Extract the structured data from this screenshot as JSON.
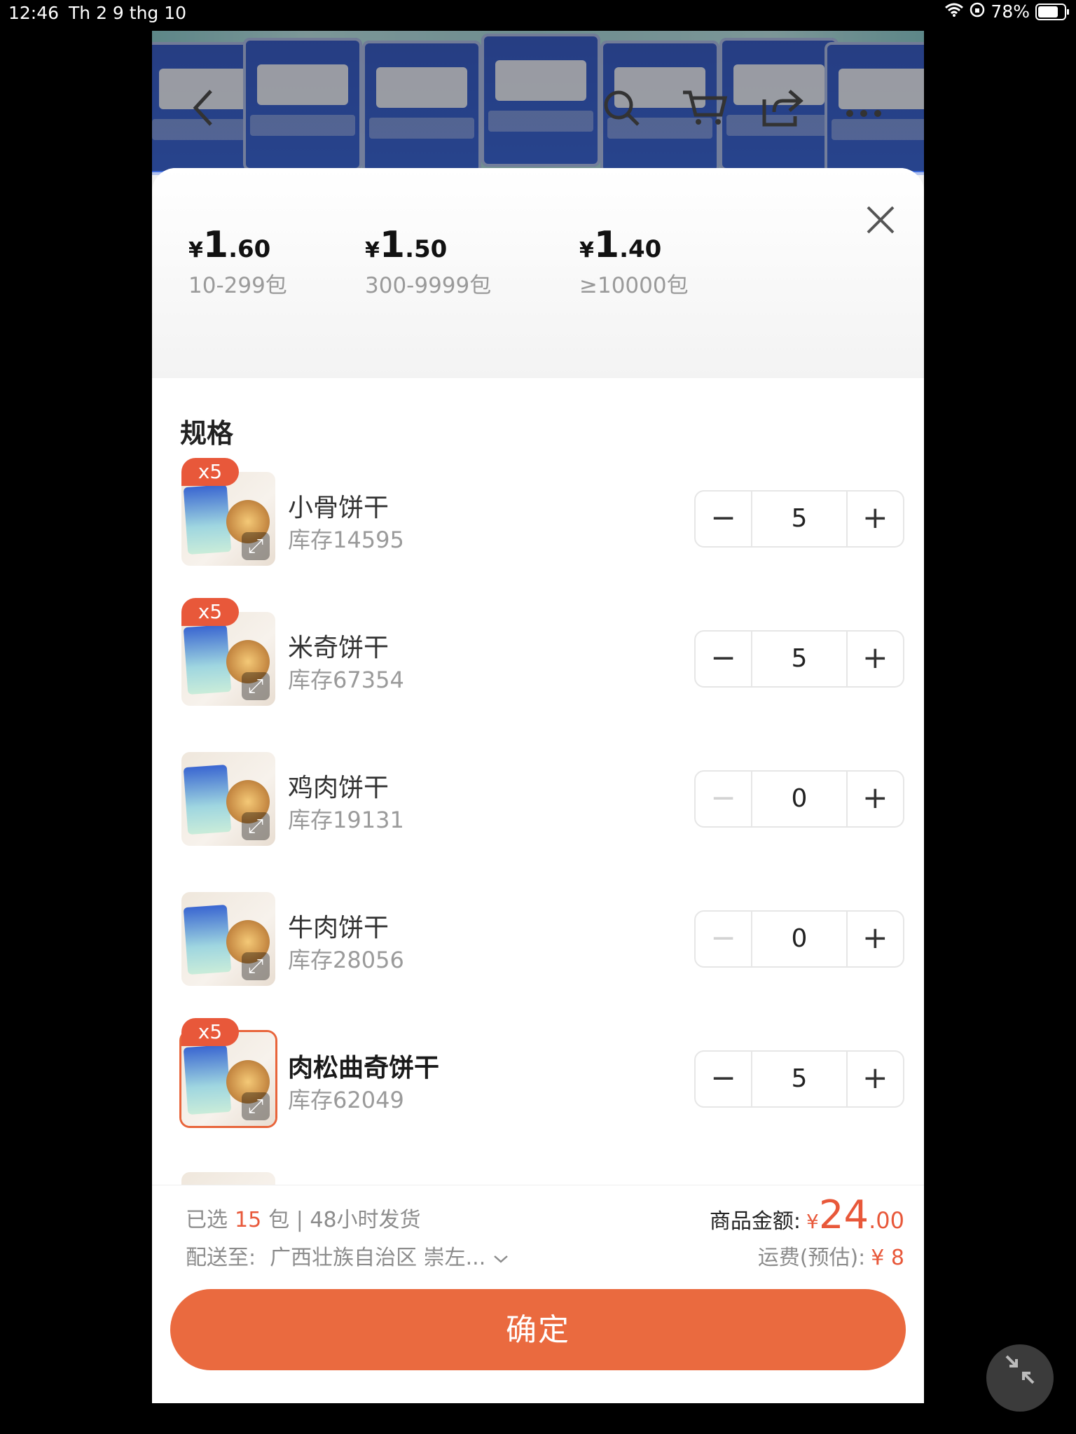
{
  "status_bar": {
    "time": "12:46",
    "date": "Th 2 9 thg 10",
    "battery_percent": "78%"
  },
  "nav": {
    "back_icon": "chevron-left-icon",
    "search_icon": "search-icon",
    "cart_icon": "cart-icon",
    "share_icon": "share-icon",
    "more_icon": "more-icon"
  },
  "price_tiers": [
    {
      "yen": "¥",
      "int": "1",
      "dec": ".60",
      "range": "10-299包"
    },
    {
      "yen": "¥",
      "int": "1",
      "dec": ".50",
      "range": "300-9999包"
    },
    {
      "yen": "¥",
      "int": "1",
      "dec": ".40",
      "range": "≥10000包"
    }
  ],
  "spec_title": "规格",
  "items": [
    {
      "badge": "x5",
      "name": "小骨饼干",
      "stock": "库存14595",
      "qty": "5",
      "minus": "−",
      "plus": "+"
    },
    {
      "badge": "x5",
      "name": "米奇饼干",
      "stock": "库存67354",
      "qty": "5",
      "minus": "−",
      "plus": "+"
    },
    {
      "badge": "",
      "name": "鸡肉饼干",
      "stock": "库存19131",
      "qty": "0",
      "minus": "−",
      "plus": "+"
    },
    {
      "badge": "",
      "name": "牛肉饼干",
      "stock": "库存28056",
      "qty": "0",
      "minus": "−",
      "plus": "+"
    },
    {
      "badge": "x5",
      "name": "肉松曲奇饼干",
      "stock": "库存62049",
      "qty": "5",
      "minus": "−",
      "plus": "+"
    }
  ],
  "footer": {
    "selected_prefix": "已选",
    "selected_count": "15",
    "selected_suffix": "包 | 48小时发货",
    "ship_label": "配送至:",
    "ship_address": "广西壮族自治区 崇左...",
    "amount_label": "商品金额:",
    "amount_yen": "¥",
    "amount_int": "24",
    "amount_dec": ".00",
    "freight_label": "运费(预估):",
    "freight_value": "¥ 8",
    "confirm_label": "确定"
  },
  "colors": {
    "accent": "#ea6a3f",
    "badge": "#e8583a"
  }
}
